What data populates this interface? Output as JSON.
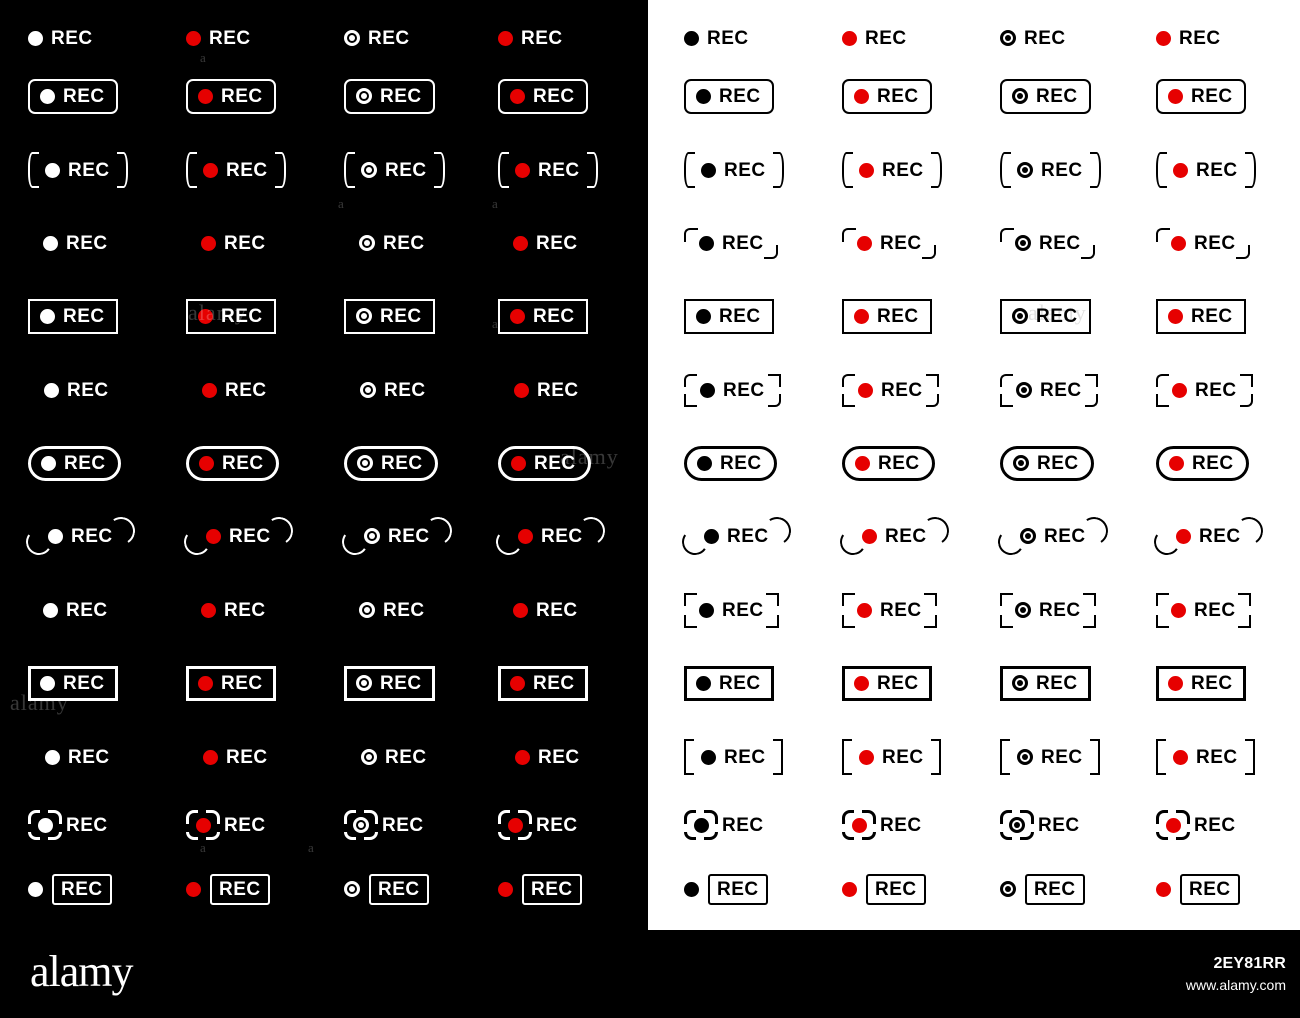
{
  "image": {
    "subject": "REC recording badge icon set",
    "label": "REC",
    "panels": [
      {
        "id": "dark",
        "background": "#000000",
        "foreground": "#ffffff"
      },
      {
        "id": "light",
        "background": "#ffffff",
        "foreground": "#000000"
      }
    ],
    "accent_red": "#e60000",
    "columns": 4,
    "rows": 13,
    "column_styles": [
      "solid-light-dot",
      "red-dot",
      "ring-dot",
      "solid-red-dot"
    ],
    "row_styles": [
      "no-frame",
      "rounded-rectangle",
      "parentheses",
      "corner-brackets-rounded",
      "rectangle",
      "dashed-corner-brackets",
      "pill",
      "arcs",
      "viewfinder-corners",
      "thick-rectangle",
      "square-brackets",
      "camera-square",
      "boxed-text"
    ]
  },
  "footer": {
    "logo": "alamy",
    "image_id": "2EY81RR",
    "url": "www.alamy.com"
  },
  "watermarks": {
    "text": "alamy",
    "short": "a"
  }
}
